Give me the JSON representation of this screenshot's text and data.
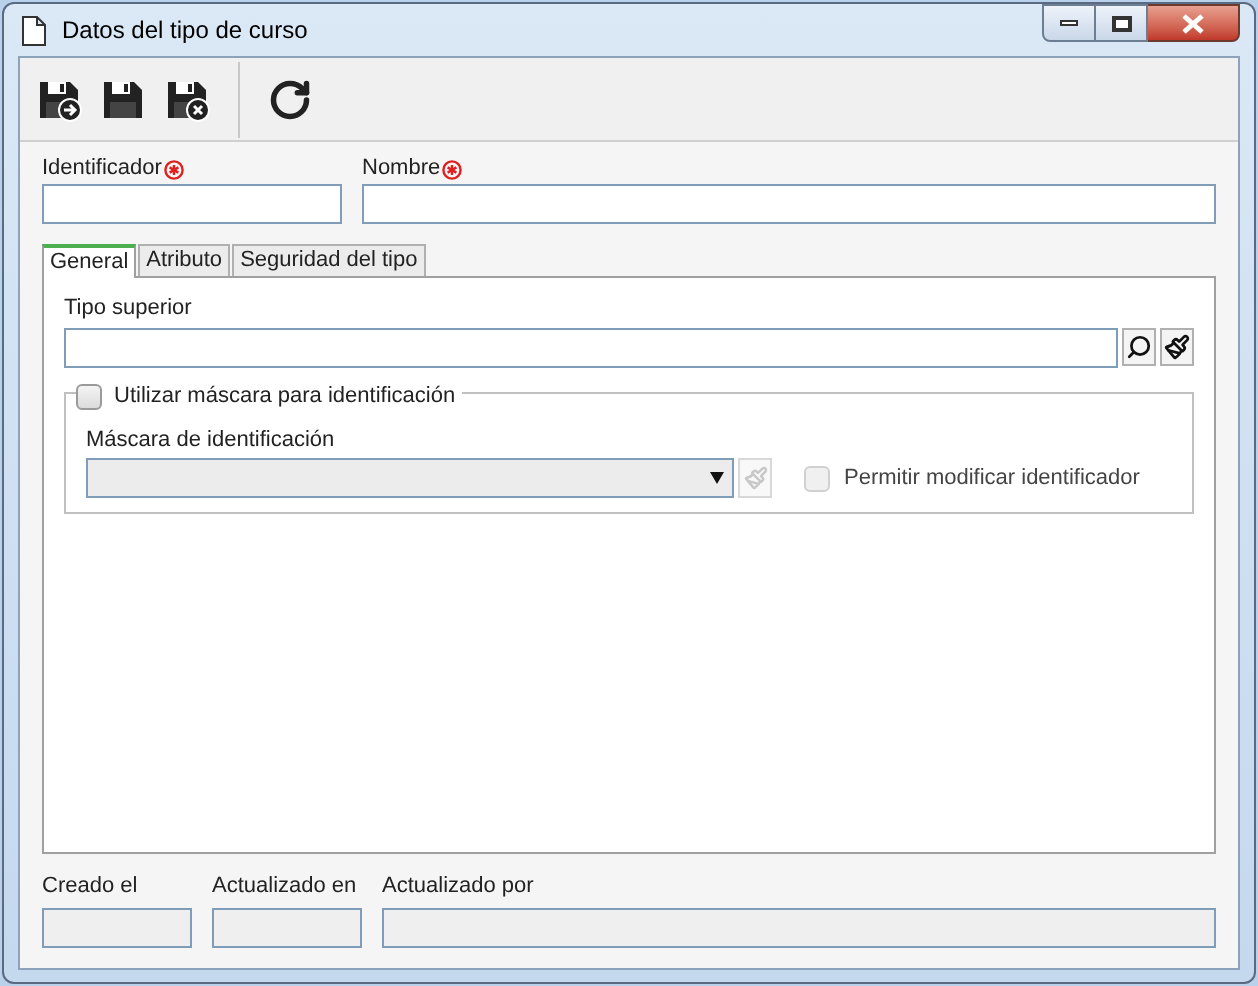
{
  "window": {
    "title": "Datos del tipo de curso"
  },
  "toolbar": [
    {
      "kind": "save_new"
    },
    {
      "kind": "save"
    },
    {
      "kind": "save_close"
    },
    {
      "kind": "separator"
    },
    {
      "kind": "refresh"
    }
  ],
  "header_fields": [
    {
      "label": "Identificador",
      "required": true
    },
    {
      "label": "Nombre",
      "required": true
    }
  ],
  "tabs": [
    {
      "label": "General",
      "selected": true
    },
    {
      "label": "Atributo",
      "selected": false
    },
    {
      "label": "Seguridad del tipo",
      "selected": false
    }
  ],
  "general": {
    "parent_type": {
      "label": "Tipo superior"
    },
    "mask_group": {
      "label": "Utilizar máscara para identificación",
      "checked": false,
      "mask_select": {
        "label": "Máscara de identificación",
        "disabled": true
      },
      "allow_modify": {
        "label": "Permitir modificar identificador",
        "checked": false,
        "disabled": true
      }
    }
  },
  "footer_fields": [
    {
      "label": "Creado el"
    },
    {
      "label": "Actualizado en"
    },
    {
      "label": "Actualizado por"
    }
  ]
}
